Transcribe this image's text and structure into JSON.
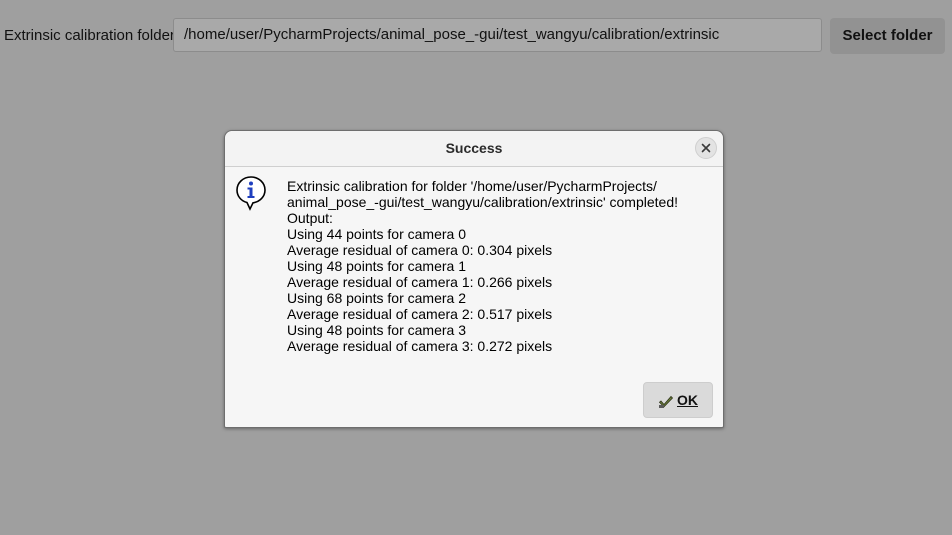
{
  "folder_bar": {
    "label": "Extrinsic calibration folder:",
    "path_value": "/home/user/PycharmProjects/animal_pose_-gui/test_wangyu/calibration/extrinsic",
    "select_button": "Select folder"
  },
  "dialog": {
    "title": "Success",
    "icon": "info-icon",
    "message_lines": [
      "Extrinsic calibration for folder '/home/user/PycharmProjects/",
      "animal_pose_-gui/test_wangyu/calibration/extrinsic' completed!",
      "Output:",
      "Using 44 points for camera 0",
      "Average residual of camera 0: 0.304 pixels",
      "Using 48 points for camera 1",
      "Average residual of camera 1: 0.266 pixels",
      "Using 68 points for camera 2",
      "Average residual of camera 2: 0.517 pixels",
      "Using 48 points for camera 3",
      "Average residual of camera 3: 0.272 pixels"
    ],
    "ok_button": "OK",
    "close_icon": "close-icon"
  },
  "colors": {
    "backdrop": "#9f9f9f",
    "dialog_bg": "#f6f6f6",
    "info_blue": "#1f3fbf"
  }
}
